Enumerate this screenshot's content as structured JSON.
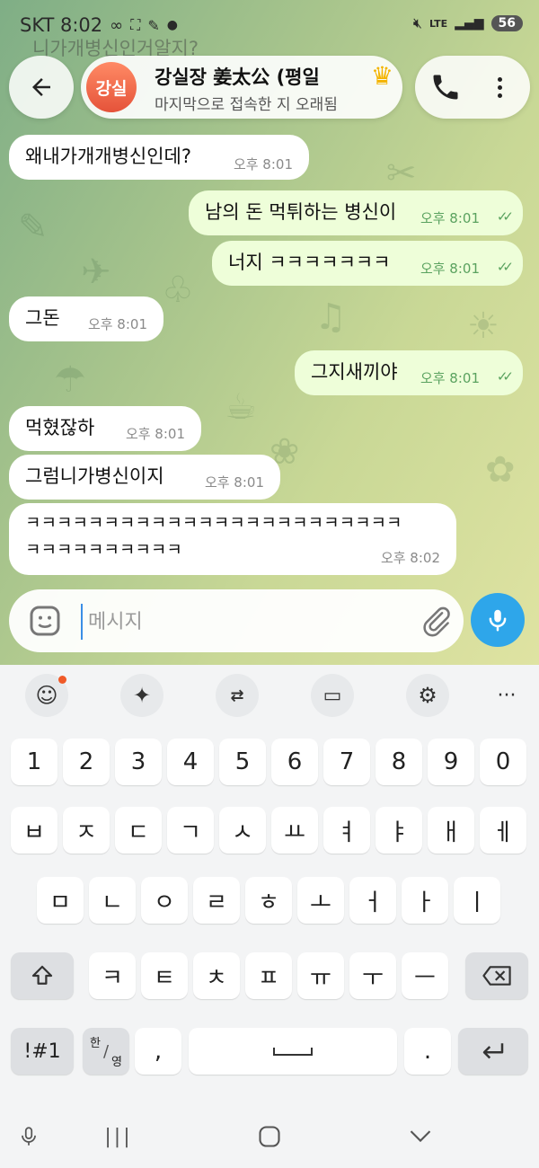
{
  "status_bar": {
    "carrier_time": "SKT 8:02",
    "network": "LTE",
    "battery": "56"
  },
  "ghost_message": "니가개병신인거알지?",
  "header": {
    "avatar_initials": "강실",
    "title": "강실장 姜太公 (평일",
    "subtitle": "마지막으로 접속한 지 오래됨",
    "avatar_color": "#e5533a"
  },
  "messages": [
    {
      "text": "왜내가개개병신인데?",
      "time": "오후 8:01",
      "dir": "in"
    },
    {
      "text": "남의 돈 먹튀하는 병신이",
      "time": "오후 8:01",
      "dir": "out"
    },
    {
      "text": "너지 ㅋㅋㅋㅋㅋㅋㅋ",
      "time": "오후 8:01",
      "dir": "out"
    },
    {
      "text": "그돈",
      "time": "오후 8:01",
      "dir": "in"
    },
    {
      "text": "그지새끼야",
      "time": "오후 8:01",
      "dir": "out"
    },
    {
      "text": "먹혔잖하",
      "time": "오후 8:01",
      "dir": "in"
    },
    {
      "text": "그럼니가병신이지",
      "time": "오후 8:01",
      "dir": "in"
    },
    {
      "text_line1": "ㅋㅋㅋㅋㅋㅋㅋㅋㅋㅋㅋㅋㅋㅋㅋㅋㅋㅋㅋㅋㅋㅋㅋㅋ",
      "text_line2": "ㅋㅋㅋㅋㅋㅋㅋㅋㅋㅋ",
      "time": "오후 8:02",
      "dir": "in"
    }
  ],
  "composer": {
    "placeholder": "메시지"
  },
  "keyboard": {
    "number_row": [
      "1",
      "2",
      "3",
      "4",
      "5",
      "6",
      "7",
      "8",
      "9",
      "0"
    ],
    "row1": [
      "ㅂ",
      "ㅈ",
      "ㄷ",
      "ㄱ",
      "ㅅ",
      "ㅛ",
      "ㅕ",
      "ㅑ",
      "ㅐ",
      "ㅔ"
    ],
    "row2": [
      "ㅁ",
      "ㄴ",
      "ㅇ",
      "ㄹ",
      "ㅎ",
      "ㅗ",
      "ㅓ",
      "ㅏ",
      "ㅣ"
    ],
    "row3": [
      "ㅋ",
      "ㅌ",
      "ㅊ",
      "ㅍ",
      "ㅠ",
      "ㅜ",
      "ㅡ"
    ],
    "symbols_key": "!#1",
    "lang_key_top": "한",
    "lang_key_bottom": "영",
    "comma_key": ",",
    "period_key": "."
  },
  "colors": {
    "outgoing_bubble": "#eefed9",
    "incoming_bubble": "#ffffff",
    "accent": "#2ea6ea",
    "check_color": "#5aa25f"
  }
}
